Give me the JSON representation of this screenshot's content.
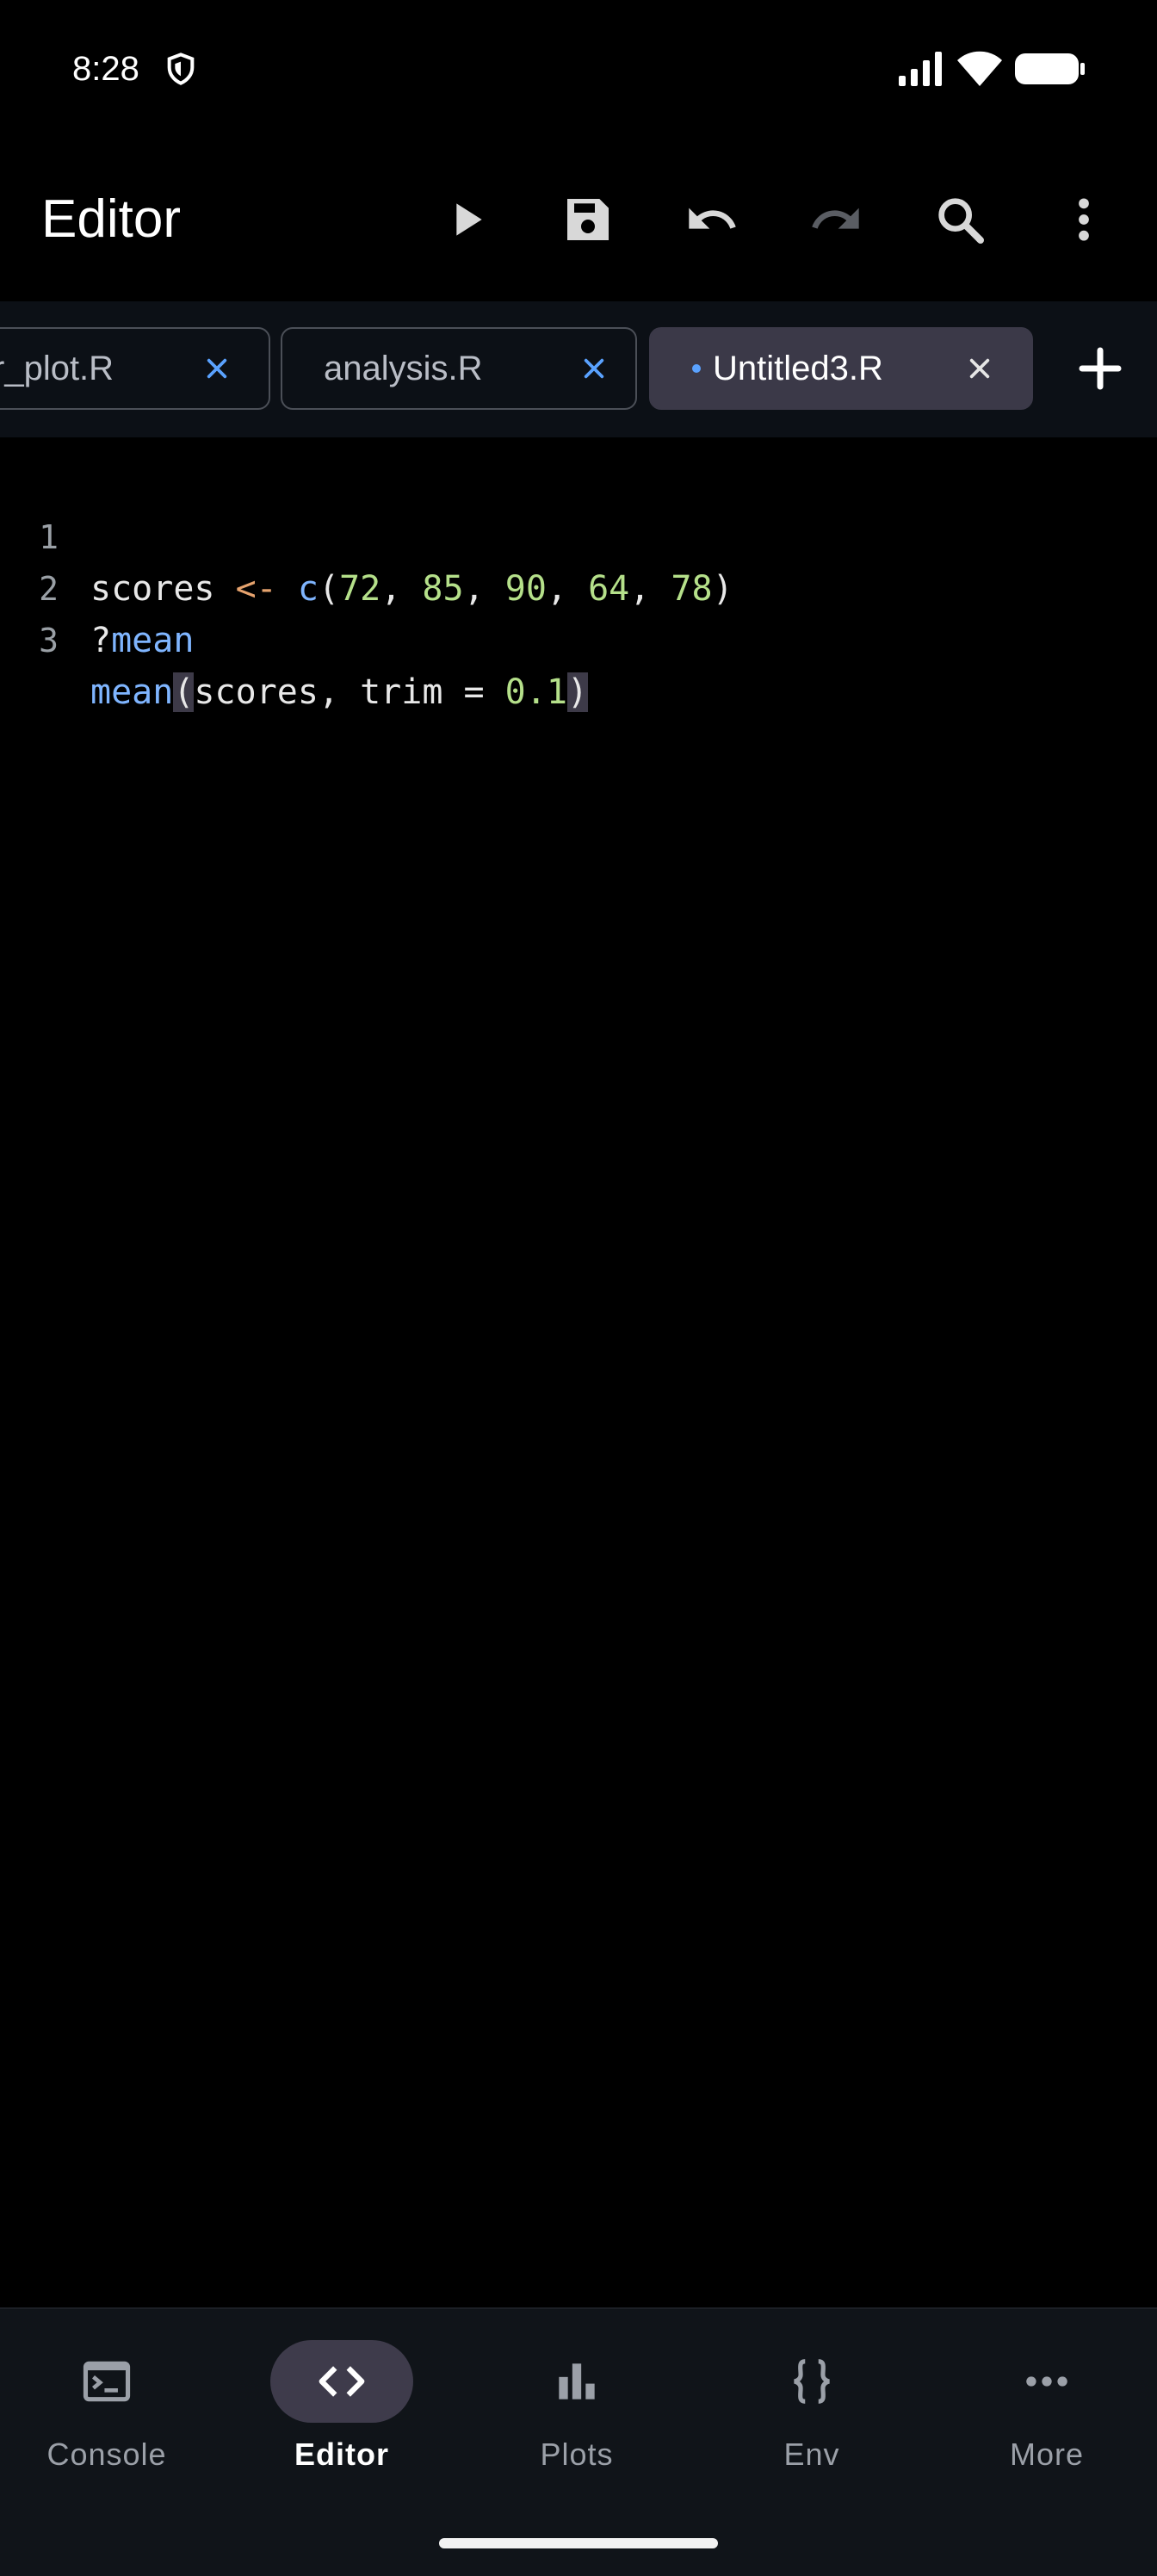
{
  "status_bar": {
    "time": "8:28",
    "icons": [
      "shield-icon",
      "signal-icon",
      "wifi-icon",
      "battery-icon"
    ]
  },
  "app_bar": {
    "title": "Editor",
    "actions": [
      "run-icon",
      "save-icon",
      "undo-icon",
      "redo-icon",
      "search-icon",
      "more-vert-icon"
    ]
  },
  "tabs": [
    {
      "label": "r_plot.R",
      "active": false,
      "modified": false
    },
    {
      "label": "analysis.R",
      "active": false,
      "modified": false
    },
    {
      "label": "Untitled3.R",
      "active": true,
      "modified": true
    }
  ],
  "editor": {
    "lines": [
      {
        "number": "1",
        "code": "scores <- c(72, 85, 90, 64, 78)"
      },
      {
        "number": "2",
        "code": "?mean"
      },
      {
        "number": "3",
        "code": "mean(scores, trim = 0.1)"
      }
    ]
  },
  "bottom_nav": {
    "items": [
      {
        "label": "Console",
        "icon": "terminal-icon",
        "active": false
      },
      {
        "label": "Editor",
        "icon": "code-icon",
        "active": true
      },
      {
        "label": "Plots",
        "icon": "bar-chart-icon",
        "active": false
      },
      {
        "label": "Env",
        "icon": "braces-icon",
        "active": false
      },
      {
        "label": "More",
        "icon": "more-horiz-icon",
        "active": false
      }
    ]
  },
  "colors": {
    "background": "#000000",
    "accent": "#5aa2ff",
    "active_tab": "#3b3948",
    "nav_background": "#101419"
  }
}
